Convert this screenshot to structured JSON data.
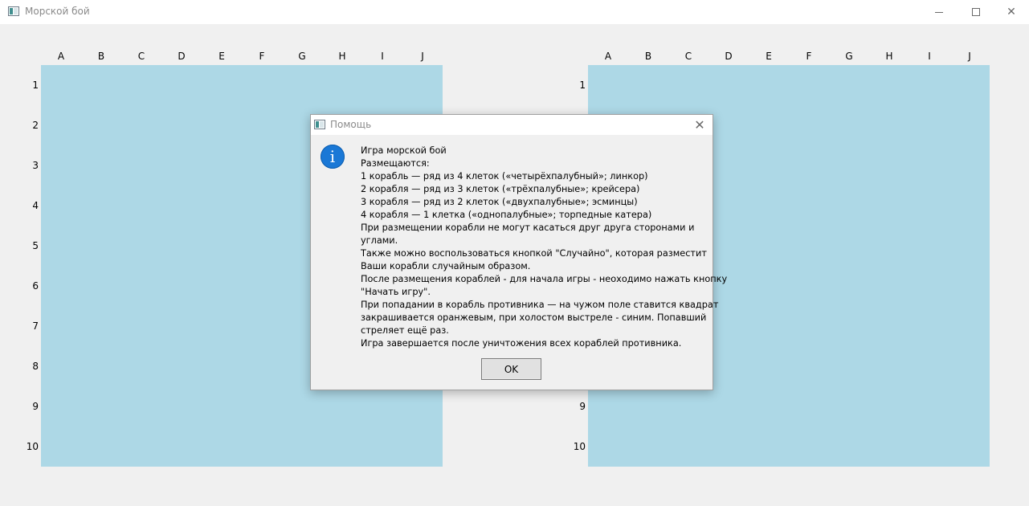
{
  "window": {
    "title": "Морской бой",
    "minimize_icon": "minimize-icon",
    "maximize_icon": "maximize-icon",
    "close_glyph": "✕"
  },
  "board": {
    "columns": [
      "A",
      "B",
      "C",
      "D",
      "E",
      "F",
      "G",
      "H",
      "I",
      "J"
    ],
    "rows": [
      "1",
      "2",
      "3",
      "4",
      "5",
      "6",
      "7",
      "8",
      "9",
      "10"
    ],
    "water_color": "#add8e6"
  },
  "dialog": {
    "title": "Помощь",
    "close_glyph": "✕",
    "icon_glyph": "i",
    "lines": [
      "Игра морской бой",
      "Размещаются:",
      "1 корабль — ряд из 4 клеток («четырёхпалубный»; линкор)",
      "2 корабля — ряд из 3 клеток («трёхпалубные»; крейсера)",
      "3 корабля — ряд из 2 клеток («двухпалубные»; эсминцы)",
      "4 корабля — 1 клетка («однопалубные»; торпедные катера)",
      "При размещении корабли не могут касаться друг друга сторонами и",
      "углами.",
      "Также можно воспользоваться кнопкой \"Случайно\", которая разместит",
      "Ваши корабли случайным образом.",
      "После размещения кораблей - для начала игры - неоходимо нажать кнопку",
      "\"Начать игру\".",
      "При попадании в корабль противника — на чужом поле ставится квадрат",
      "закрашивается оранжевым, при холостом выстреле - синим. Попавший",
      "стреляет ещё раз.",
      "Игра завершается после уничтожения всех кораблей противника."
    ],
    "ok_label": "OK"
  }
}
